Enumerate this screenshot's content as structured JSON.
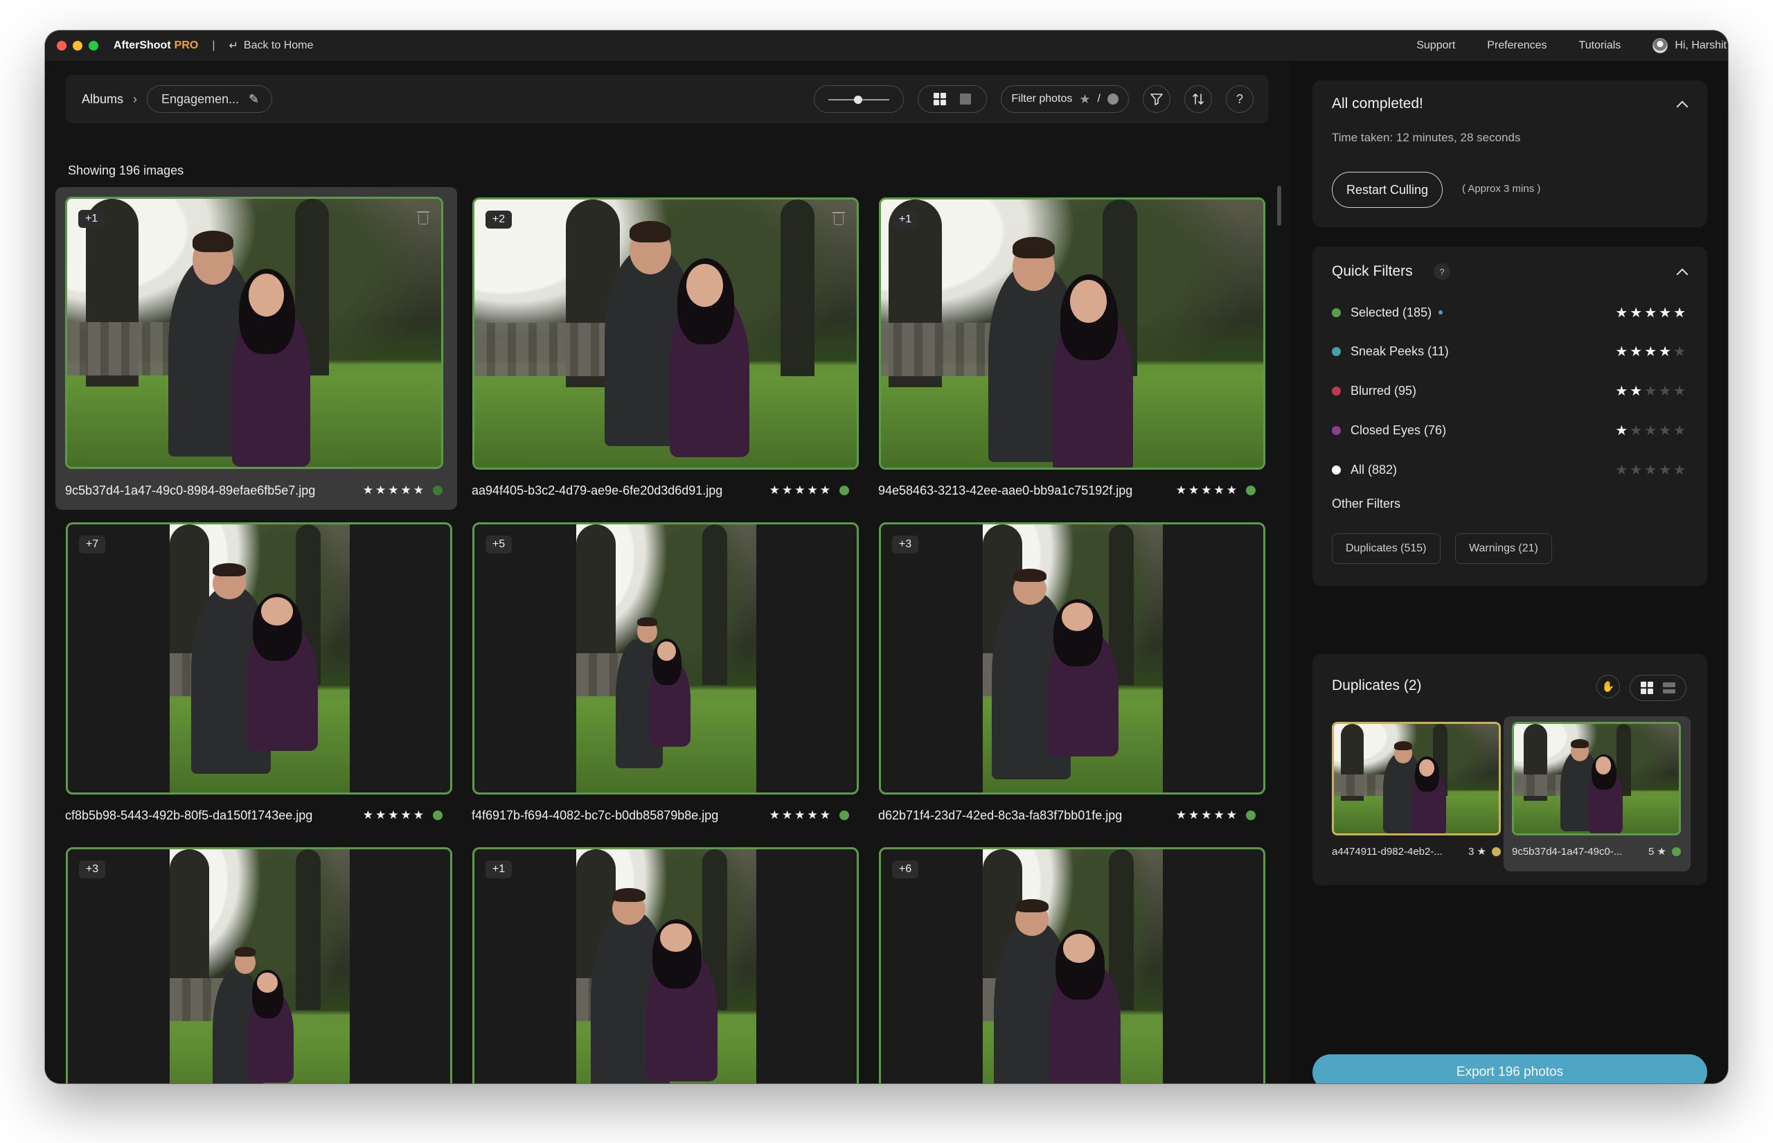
{
  "titlebar": {
    "app_name": "AfterShoot",
    "app_suffix": "PRO",
    "separator": "|",
    "back_label": "Back to Home",
    "menu": [
      "Support",
      "Preferences",
      "Tutorials"
    ],
    "user_greeting": "Hi, Harshit"
  },
  "toolbar": {
    "albums_label": "Albums",
    "album_name": "Engagemen...",
    "filter_label": "Filter photos",
    "filter_slash": "/",
    "filter_icon": "funnel-icon",
    "sort_icon": "sort-arrows-icon",
    "help_label": "?"
  },
  "showing_text": "Showing 196 images",
  "photos": [
    {
      "badge": "+1",
      "filename": "9c5b37d4-1a47-49c0-8984-89efae6fb5e7.jpg",
      "stars": "★★★★★",
      "selected": true,
      "orientation": "landscape",
      "has_trash": true
    },
    {
      "badge": "+2",
      "filename": "aa94f405-b3c2-4d79-ae9e-6fe20d3d6d91.jpg",
      "stars": "★★★★★",
      "selected": false,
      "orientation": "landscape",
      "has_trash": true
    },
    {
      "badge": "+1",
      "filename": "94e58463-3213-42ee-aae0-bb9a1c75192f.jpg",
      "stars": "★★★★★",
      "selected": false,
      "orientation": "landscape",
      "has_trash": false
    },
    {
      "badge": "+7",
      "filename": "cf8b5b98-5443-492b-80f5-da150f1743ee.jpg",
      "stars": "★★★★★",
      "selected": false,
      "orientation": "portrait",
      "has_trash": false
    },
    {
      "badge": "+5",
      "filename": "f4f6917b-f694-4082-bc7c-b0db85879b8e.jpg",
      "stars": "★★★★★",
      "selected": false,
      "orientation": "portrait",
      "has_trash": false
    },
    {
      "badge": "+3",
      "filename": "d62b71f4-23d7-42ed-8c3a-fa83f7bb01fe.jpg",
      "stars": "★★★★★",
      "selected": false,
      "orientation": "portrait",
      "has_trash": false
    },
    {
      "badge": "+3",
      "filename": "",
      "stars": "",
      "selected": false,
      "orientation": "portrait",
      "has_trash": false
    },
    {
      "badge": "+1",
      "filename": "",
      "stars": "",
      "selected": false,
      "orientation": "portrait",
      "has_trash": false
    },
    {
      "badge": "+6",
      "filename": "",
      "stars": "",
      "selected": false,
      "orientation": "portrait",
      "has_trash": false
    }
  ],
  "status_panel": {
    "title": "All completed!",
    "time_taken": "Time taken: 12 minutes, 28 seconds",
    "restart_label": "Restart Culling",
    "approx": "( Approx 3 mins )"
  },
  "quick_filters": {
    "title": "Quick Filters",
    "help": "?",
    "items": [
      {
        "label": "Selected (185)",
        "color": "#59a148",
        "stars_on": "★★★★★",
        "stars_off": "",
        "live": true
      },
      {
        "label": "Sneak Peeks (11)",
        "color": "#3fa3a8",
        "stars_on": "★★★★",
        "stars_off": "★",
        "live": false
      },
      {
        "label": "Blurred (95)",
        "color": "#c0394b",
        "stars_on": "★★",
        "stars_off": "★★★",
        "live": false
      },
      {
        "label": "Closed Eyes (76)",
        "color": "#8a3e8e",
        "stars_on": "★",
        "stars_off": "★★★★",
        "live": false
      },
      {
        "label": "All (882)",
        "color": "#ffffff",
        "stars_on": "",
        "stars_off": "★★★★★",
        "live": false
      }
    ],
    "other_title": "Other Filters",
    "chips": [
      "Duplicates (515)",
      "Warnings (21)"
    ]
  },
  "duplicates": {
    "title": "Duplicates (2)",
    "items": [
      {
        "name": "a4474911-d982-4eb2-...",
        "rating": "3 ★",
        "dot_color": "#c9b25a",
        "border": "#c9b25a",
        "selected": false
      },
      {
        "name": "9c5b37d4-1a47-49c0-...",
        "rating": "5 ★",
        "dot_color": "#59a148",
        "border": "#5d9a4a",
        "selected": true
      }
    ]
  },
  "export_label": "Export 196 photos"
}
